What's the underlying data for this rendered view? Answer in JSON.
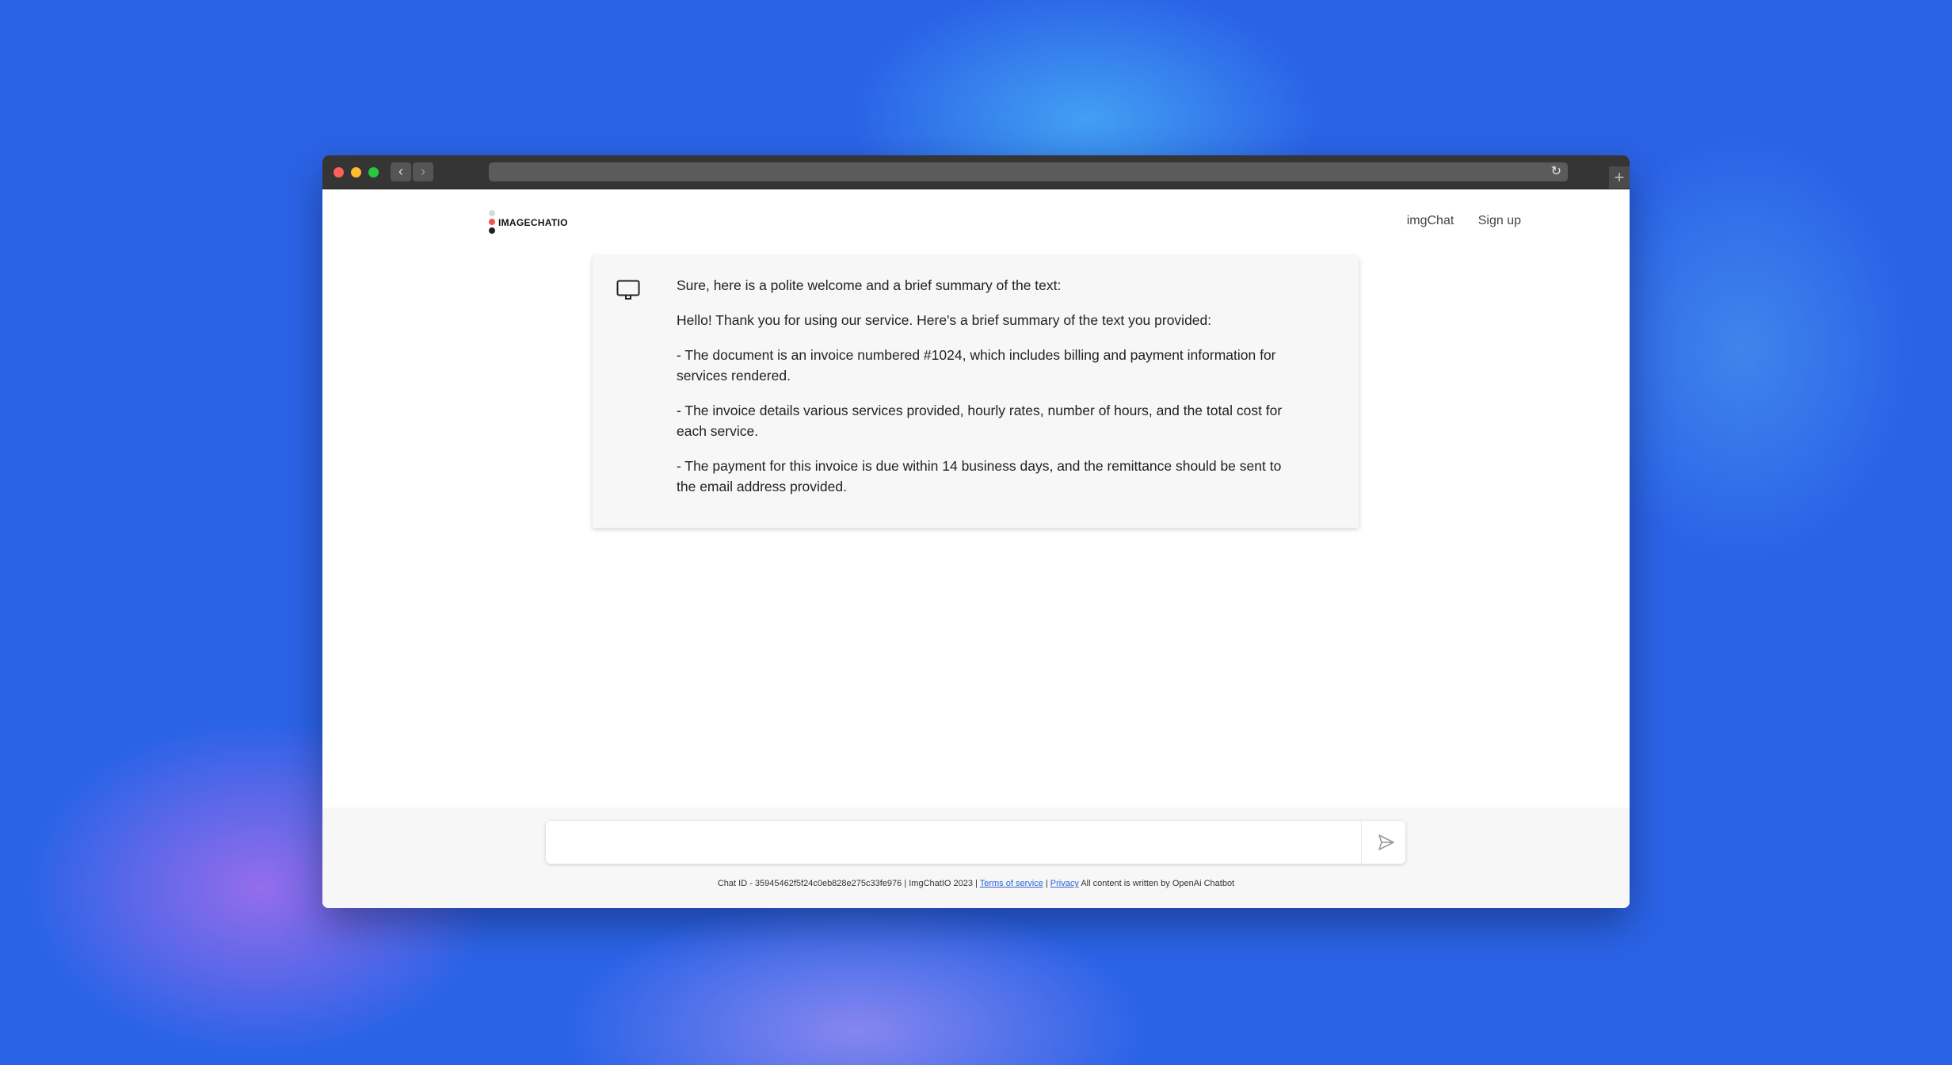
{
  "header": {
    "logo_text": "IMAGECHATIO",
    "nav": [
      "imgChat",
      "Sign up"
    ]
  },
  "message": {
    "paragraphs": [
      "Sure, here is a polite welcome and a brief summary of the text:",
      "Hello! Thank you for using our service. Here's a brief summary of the text you provided:",
      "- The document is an invoice numbered #1024, which includes billing and payment information for services rendered.",
      "- The invoice details various services provided, hourly rates, number of hours, and the total cost for each service.",
      "- The payment for this invoice is due within 14 business days, and the remittance should be sent to the email address provided."
    ]
  },
  "composer": {
    "value": "",
    "placeholder": ""
  },
  "footer": {
    "chat_id": "Chat ID - 35945462f5f24c0eb828e275c33fe976 | ImgChatIO 2023 |",
    "terms_label": "Terms of service",
    "separator": "|",
    "privacy_label": "Privacy",
    "trailing": "All content is written by OpenAi Chatbot"
  },
  "colors": {
    "background": "#2b63e7",
    "titlebar": "#353535",
    "card": "#f7f7f7",
    "link": "#2a62d6",
    "logo_red": "#f25454"
  },
  "icons": [
    "monitor-icon",
    "send-icon",
    "reload-icon",
    "chevron-left-icon",
    "chevron-right-icon",
    "plus-icon"
  ]
}
